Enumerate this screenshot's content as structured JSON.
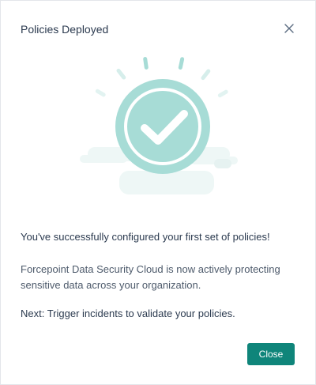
{
  "dialog": {
    "title": "Policies Deployed",
    "success_message": "You've successfully configured your first set of policies!",
    "description": "Forcepoint Data Security Cloud is now actively protecting sensitive data across your organization.",
    "next_step": "Next: Trigger incidents to validate your policies.",
    "close_button_label": "Close"
  },
  "icons": {
    "close": "close-icon",
    "illustration": "success-check-icon"
  },
  "colors": {
    "accent": "#0f857a",
    "check_circle": "#a7dcd6",
    "check_circle_inner": "#8fd0c8",
    "illustration_bg": "#eef7f6"
  }
}
